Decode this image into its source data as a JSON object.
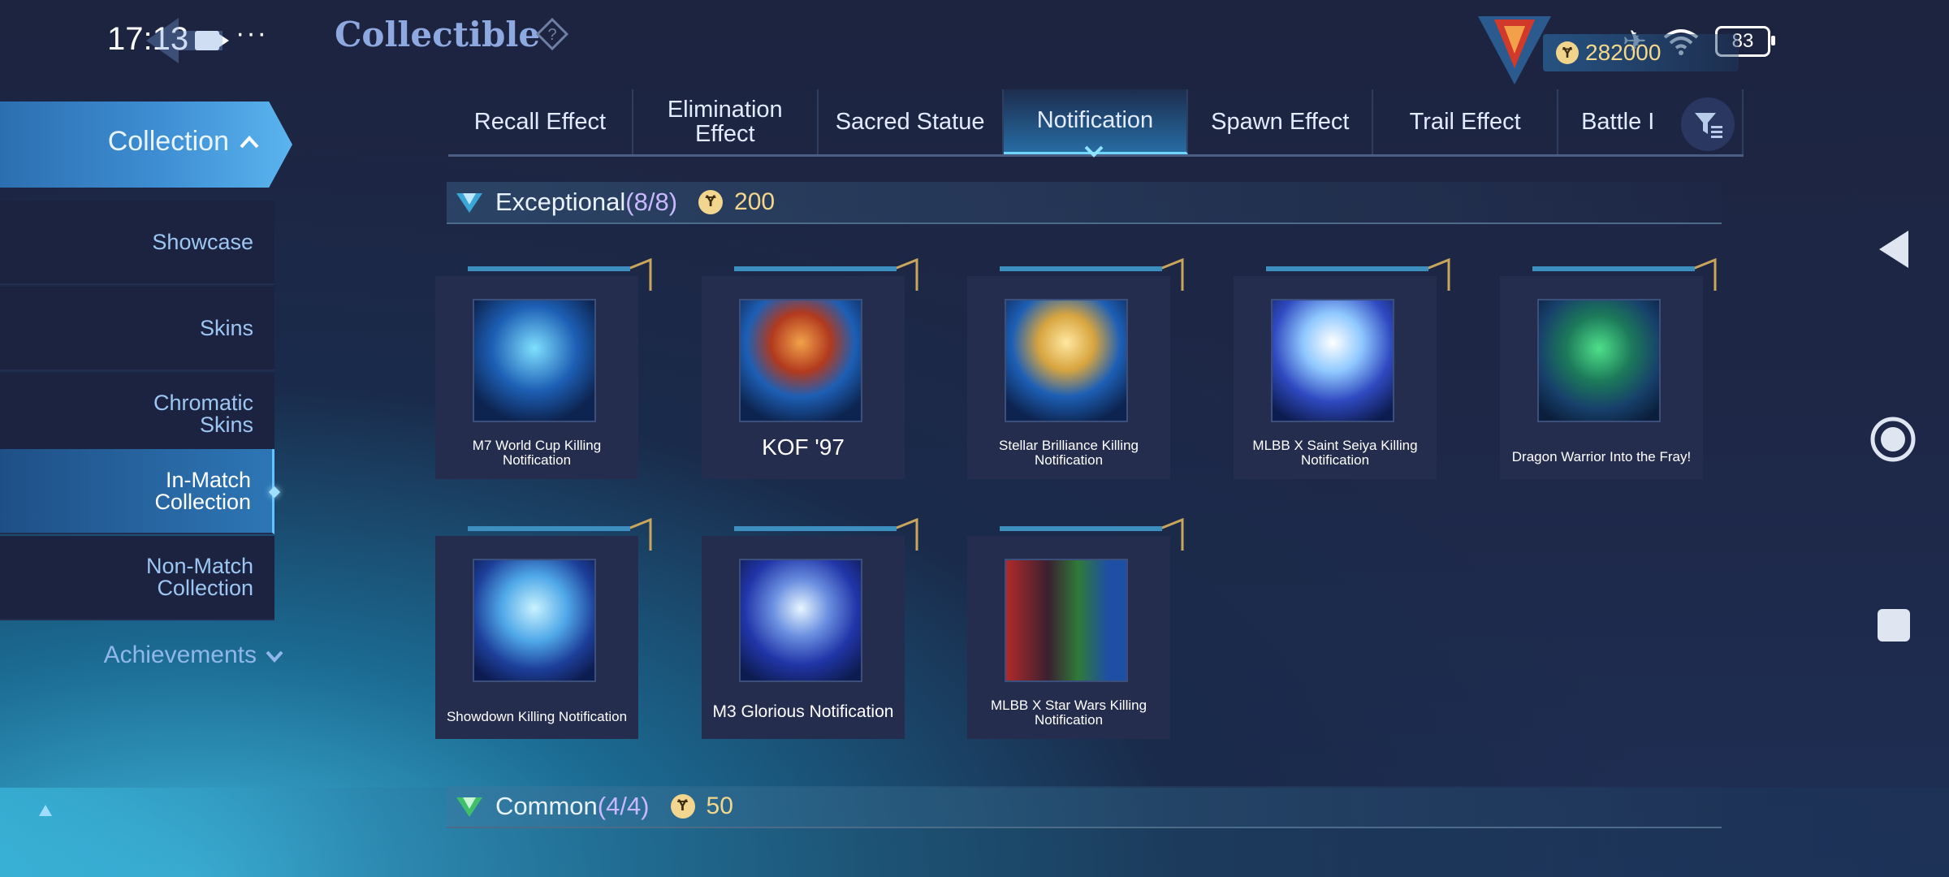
{
  "status": {
    "time": "17:13",
    "battery": "83"
  },
  "header": {
    "title": "Collectible"
  },
  "currency": {
    "amount": "282000"
  },
  "sidebar": {
    "head": "Collection",
    "items": [
      {
        "label": "Showcase"
      },
      {
        "label": "Skins"
      },
      {
        "label": "Chromatic Skins"
      },
      {
        "label": "In-Match Collection"
      },
      {
        "label": "Non-Match Collection"
      }
    ],
    "achievements": "Achievements"
  },
  "tabs": [
    {
      "label": "Recall Effect"
    },
    {
      "label": "Elimination Effect"
    },
    {
      "label": "Sacred Statue"
    },
    {
      "label": "Notification"
    },
    {
      "label": "Spawn Effect"
    },
    {
      "label": "Trail Effect"
    },
    {
      "label": "Battle I"
    }
  ],
  "exceptional": {
    "name": "Exceptional",
    "count": "(8/8)",
    "price": "200"
  },
  "common": {
    "name": "Common",
    "count": "(4/4)",
    "price": "50"
  },
  "cards": [
    {
      "label": "M7 World Cup Killing Notification"
    },
    {
      "label": "KOF '97"
    },
    {
      "label": "Stellar Brilliance Killing Notification"
    },
    {
      "label": "MLBB X Saint Seiya Killing Notification"
    },
    {
      "label": "Dragon Warrior Into the Fray!"
    },
    {
      "label": "Showdown Killing Notification"
    },
    {
      "label": "M3 Glorious Notification"
    },
    {
      "label": "MLBB X Star Wars Killing Notification"
    }
  ],
  "colors": {
    "accent": "#6fd6ff",
    "gold": "#f3d78c"
  }
}
